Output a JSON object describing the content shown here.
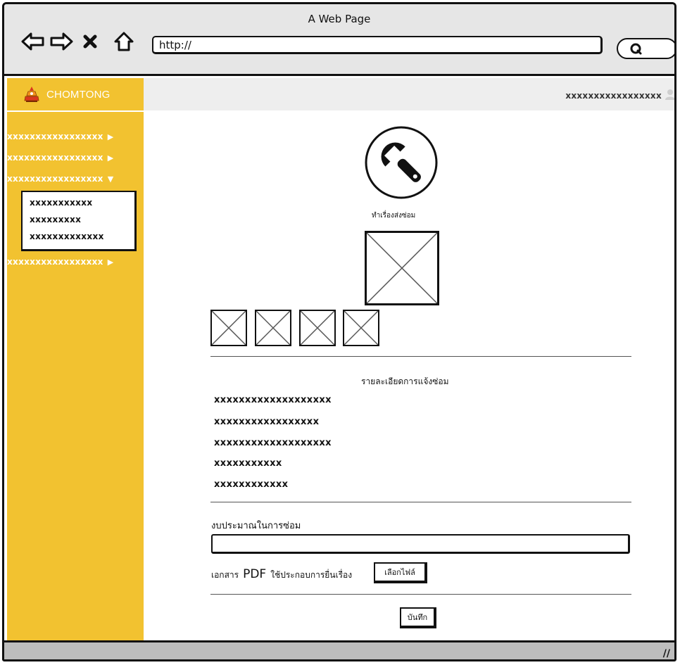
{
  "window": {
    "title": "A Web Page",
    "url": "http://"
  },
  "icons": {
    "back": "arrow-left-icon",
    "forward": "arrow-right-icon",
    "stop": "close-icon",
    "home": "home-icon",
    "search": "search-icon",
    "user": "user-icon",
    "repair": "wrench-icon",
    "logo": "chomtong-logo",
    "image": "image-placeholder-icon"
  },
  "sidebar": {
    "brand": "CHOMTONG",
    "items": [
      {
        "label": "xxxxxxxxxxxxxxxxx",
        "arrow": "▶"
      },
      {
        "label": "xxxxxxxxxxxxxxxxx",
        "arrow": "▶"
      },
      {
        "label": "xxxxxxxxxxxxxxxxx",
        "arrow": "▼"
      },
      {
        "label": "xxxxxxxxxxxxxxxxx",
        "arrow": "▶"
      }
    ],
    "submenu": [
      "xxxxxxxxxxx",
      "xxxxxxxxx",
      "xxxxxxxxxxxxx"
    ]
  },
  "topbar": {
    "user": "xxxxxxxxxxxxxxxxx"
  },
  "main": {
    "repair_caption": "ทำเรื่องส่งซ่อม",
    "details_heading": "รายละเอียดการแจ้งซ่อม",
    "details": [
      "xxxxxxxxxxxxxxxxxxx",
      "xxxxxxxxxxxxxxxxx",
      "xxxxxxxxxxxxxxxxxxx",
      "xxxxxxxxxxx",
      "xxxxxxxxxxxx"
    ],
    "budget_label": "งบประมาณในการซ่อม",
    "budget_value": "",
    "pdf_label_pre": "เอกสาร",
    "pdf_label_pdf": "PDF",
    "pdf_label_post": "ใช้ประกอบการยื่นเรื่อง",
    "choose_file": "เลือกไฟล์",
    "save": "บันทึก"
  },
  "colors": {
    "sidebar": "#f2c230",
    "topbar": "#eeeeee",
    "chrome": "#e6e6e6",
    "statusbar": "#bdbdbd"
  }
}
